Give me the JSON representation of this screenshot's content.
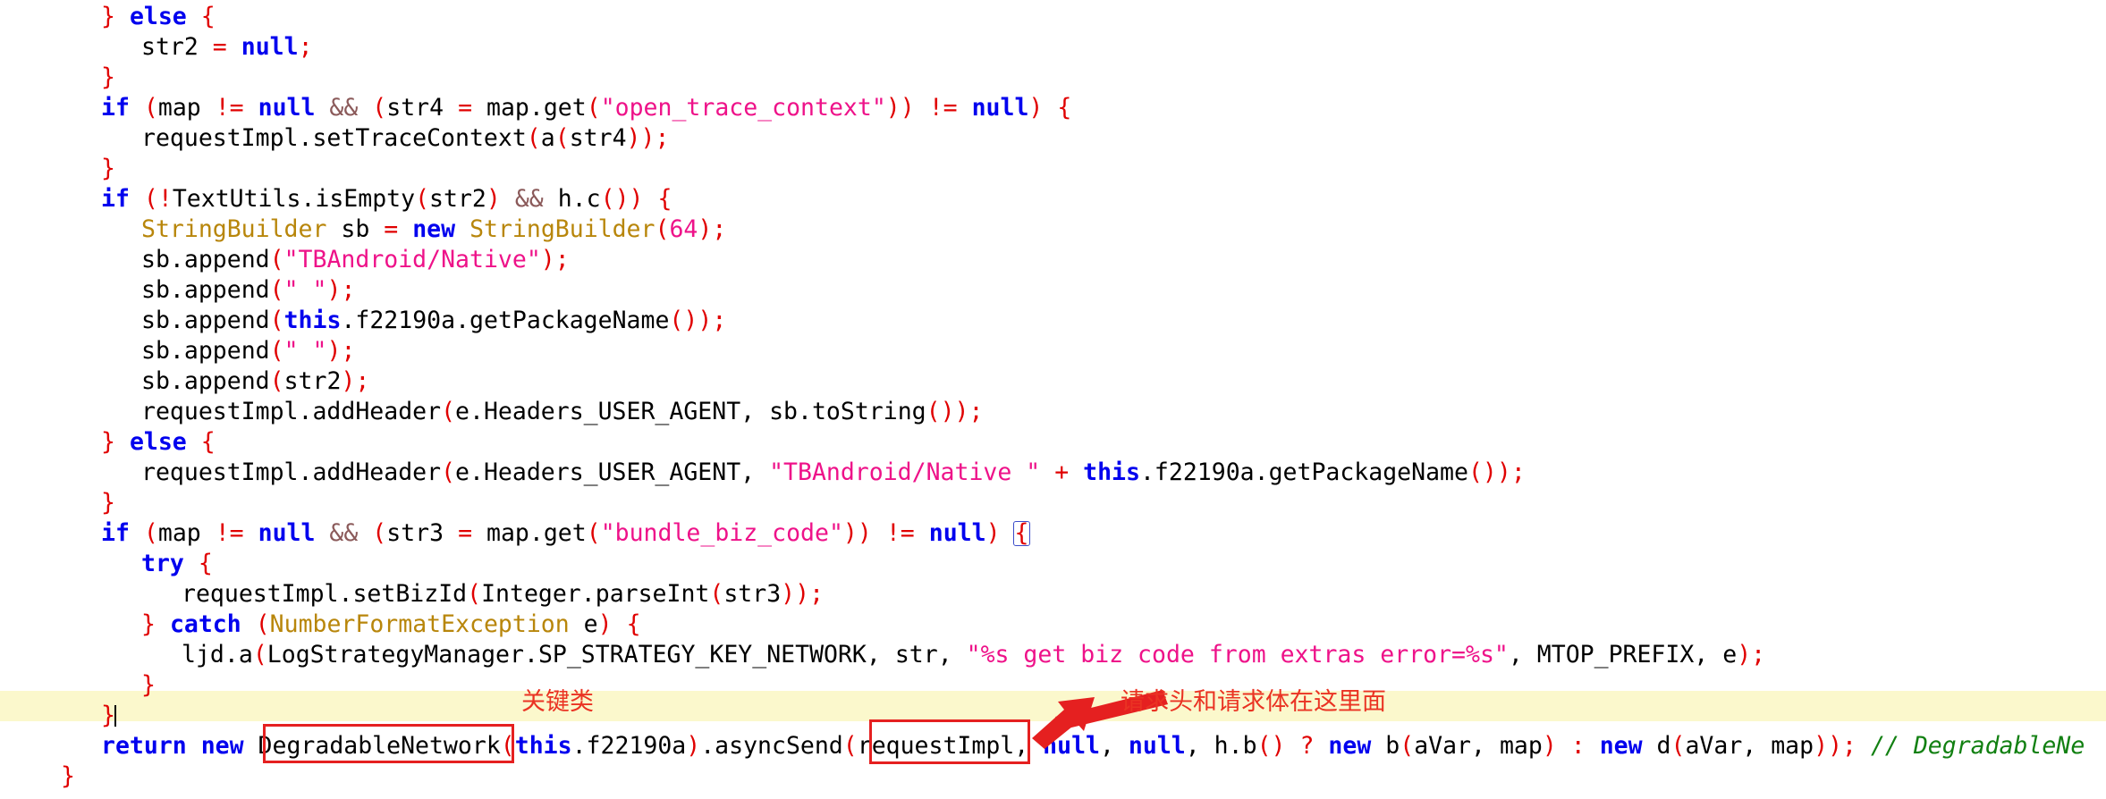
{
  "viewer": {
    "type": "decompiled-java-source-view",
    "background_color": "#ffffff",
    "highlight_band_color": "#fbf8cc",
    "annotation_color": "#ea3323"
  },
  "colors": {
    "keyword": "#0000ee",
    "punctuation": "#e00000",
    "string": "#ee1289",
    "class_name": "#b8860b",
    "operator": "#8b5a5a",
    "comment": "#128012",
    "plain": "#000000",
    "highlight_band": "#fbf8cc",
    "annotation_red": "#ea3323",
    "bracket_match_border": "#3b4cca"
  },
  "code": {
    "language": "java",
    "lines": [
      {
        "id": "l1",
        "indent": 1,
        "text": "} else {"
      },
      {
        "id": "l2",
        "indent": 2,
        "text": "str2 = null;"
      },
      {
        "id": "l3",
        "indent": 1,
        "text": "}"
      },
      {
        "id": "l4",
        "indent": 1,
        "text": "if (map != null && (str4 = map.get(\"open_trace_context\")) != null) {"
      },
      {
        "id": "l5",
        "indent": 2,
        "text": "requestImpl.setTraceContext(a(str4));"
      },
      {
        "id": "l6",
        "indent": 1,
        "text": "}"
      },
      {
        "id": "l7",
        "indent": 1,
        "text": "if (!TextUtils.isEmpty(str2) && h.c()) {"
      },
      {
        "id": "l8",
        "indent": 2,
        "text": "StringBuilder sb = new StringBuilder(64);"
      },
      {
        "id": "l9",
        "indent": 2,
        "text": "sb.append(\"TBAndroid/Native\");"
      },
      {
        "id": "l10",
        "indent": 2,
        "text": "sb.append(\" \");"
      },
      {
        "id": "l11",
        "indent": 2,
        "text": "sb.append(this.f22190a.getPackageName());"
      },
      {
        "id": "l12",
        "indent": 2,
        "text": "sb.append(\" \");"
      },
      {
        "id": "l13",
        "indent": 2,
        "text": "sb.append(str2);"
      },
      {
        "id": "l14",
        "indent": 2,
        "text": "requestImpl.addHeader(e.Headers_USER_AGENT, sb.toString());"
      },
      {
        "id": "l15",
        "indent": 1,
        "text": "} else {"
      },
      {
        "id": "l16",
        "indent": 2,
        "text": "requestImpl.addHeader(e.Headers_USER_AGENT, \"TBAndroid/Native \" + this.f22190a.getPackageName());"
      },
      {
        "id": "l17",
        "indent": 1,
        "text": "}"
      },
      {
        "id": "l18",
        "indent": 1,
        "text": "if (map != null && (str3 = map.get(\"bundle_biz_code\")) != null) {"
      },
      {
        "id": "l19",
        "indent": 2,
        "text": "try {"
      },
      {
        "id": "l20",
        "indent": 3,
        "text": "requestImpl.setBizId(Integer.parseInt(str3));"
      },
      {
        "id": "l21",
        "indent": 2,
        "text": "} catch (NumberFormatException e) {"
      },
      {
        "id": "l22",
        "indent": 3,
        "text": "ljd.a(LogStrategyManager.SP_STRATEGY_KEY_NETWORK, str, \"%s get biz code from extras error=%s\", MTOP_PREFIX, e);"
      },
      {
        "id": "l23",
        "indent": 2,
        "text": "}"
      },
      {
        "id": "l24",
        "indent": 1,
        "text": "}",
        "highlighted": true,
        "has_caret": true
      },
      {
        "id": "l25",
        "indent": 1,
        "text": "return new DegradableNetwork(this.f22190a).asyncSend(requestImpl, null, null, h.b() ? new b(aVar, map) : new d(aVar, map)); // DegradableNe"
      },
      {
        "id": "l26",
        "indent": 0,
        "text": "}"
      }
    ],
    "tokens": {
      "keywords": [
        "else",
        "if",
        "null",
        "new",
        "this",
        "try",
        "catch",
        "return"
      ],
      "class_names": [
        "StringBuilder",
        "NumberFormatException"
      ],
      "strings": [
        "\"open_trace_context\"",
        "\"TBAndroid/Native\"",
        "\" \"",
        "\"TBAndroid/Native \"",
        "\"bundle_biz_code\"",
        "\"%s get biz code from extras error=%s\""
      ],
      "identifiers": [
        "map",
        "str2",
        "str3",
        "str4",
        "requestImpl",
        "sb",
        "TextUtils",
        "isEmpty",
        "h.c",
        "h.b",
        "append",
        "getPackageName",
        "addHeader",
        "e.Headers_USER_AGENT",
        "toString",
        "setTraceContext",
        "setBizId",
        "Integer",
        "parseInt",
        "ljd.a",
        "LogStrategyManager",
        "SP_STRATEGY_KEY_NETWORK",
        "MTOP_PREFIX",
        "DegradableNetwork",
        "asyncSend",
        "f22190a",
        "aVar"
      ],
      "comment_text": "// DegradableNe",
      "numbers": [
        "64"
      ]
    }
  },
  "annotations": [
    {
      "id": "anno-key-class",
      "kind": "label",
      "text": "关键类",
      "meaning": "key class",
      "color": "#ea3323"
    },
    {
      "id": "anno-request-body",
      "kind": "label",
      "text": "请求头和请求体在这里面",
      "meaning": "request headers and request body are in here",
      "color": "#ea3323"
    },
    {
      "id": "anno-box-degradablenetwork",
      "kind": "box",
      "target_text": "DegradableNetwork",
      "color": "#e52020"
    },
    {
      "id": "anno-box-requestimpl",
      "kind": "box",
      "target_text": "requestImpl",
      "color": "#e52020"
    },
    {
      "id": "anno-arrow-requestimpl",
      "kind": "arrow",
      "direction": "down-left",
      "color": "#e52020"
    }
  ]
}
